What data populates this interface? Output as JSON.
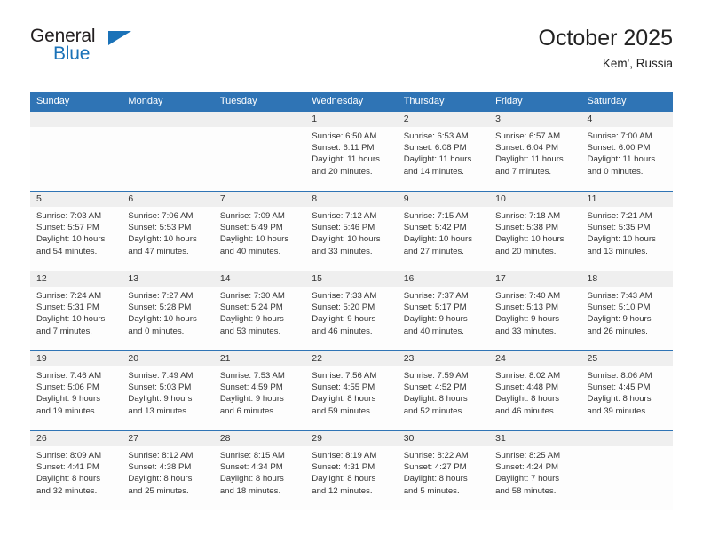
{
  "brand": {
    "name_top": "General",
    "name_bottom": "Blue",
    "mark": "triangle-logo-mark",
    "accent_color": "#1a72b8"
  },
  "header": {
    "title": "October 2025",
    "subtitle": "Kem', Russia"
  },
  "theme": {
    "header_blue": "#2f74b5",
    "datebar_gray": "#efefef",
    "text": "#333333"
  },
  "weekday_headers": [
    "Sunday",
    "Monday",
    "Tuesday",
    "Wednesday",
    "Thursday",
    "Friday",
    "Saturday"
  ],
  "labels": {
    "sunrise": "Sunrise:",
    "sunset": "Sunset:",
    "daylight": "Daylight:"
  },
  "weeks": [
    [
      {
        "day": "",
        "sunrise": "",
        "sunset": "",
        "daylight_1": "",
        "daylight_2": "",
        "empty": true
      },
      {
        "day": "",
        "sunrise": "",
        "sunset": "",
        "daylight_1": "",
        "daylight_2": "",
        "empty": true
      },
      {
        "day": "",
        "sunrise": "",
        "sunset": "",
        "daylight_1": "",
        "daylight_2": "",
        "empty": true
      },
      {
        "day": "1",
        "sunrise": "Sunrise: 6:50 AM",
        "sunset": "Sunset: 6:11 PM",
        "daylight_1": "Daylight: 11 hours",
        "daylight_2": "and 20 minutes.",
        "empty": false
      },
      {
        "day": "2",
        "sunrise": "Sunrise: 6:53 AM",
        "sunset": "Sunset: 6:08 PM",
        "daylight_1": "Daylight: 11 hours",
        "daylight_2": "and 14 minutes.",
        "empty": false
      },
      {
        "day": "3",
        "sunrise": "Sunrise: 6:57 AM",
        "sunset": "Sunset: 6:04 PM",
        "daylight_1": "Daylight: 11 hours",
        "daylight_2": "and 7 minutes.",
        "empty": false
      },
      {
        "day": "4",
        "sunrise": "Sunrise: 7:00 AM",
        "sunset": "Sunset: 6:00 PM",
        "daylight_1": "Daylight: 11 hours",
        "daylight_2": "and 0 minutes.",
        "empty": false
      }
    ],
    [
      {
        "day": "5",
        "sunrise": "Sunrise: 7:03 AM",
        "sunset": "Sunset: 5:57 PM",
        "daylight_1": "Daylight: 10 hours",
        "daylight_2": "and 54 minutes.",
        "empty": false
      },
      {
        "day": "6",
        "sunrise": "Sunrise: 7:06 AM",
        "sunset": "Sunset: 5:53 PM",
        "daylight_1": "Daylight: 10 hours",
        "daylight_2": "and 47 minutes.",
        "empty": false
      },
      {
        "day": "7",
        "sunrise": "Sunrise: 7:09 AM",
        "sunset": "Sunset: 5:49 PM",
        "daylight_1": "Daylight: 10 hours",
        "daylight_2": "and 40 minutes.",
        "empty": false
      },
      {
        "day": "8",
        "sunrise": "Sunrise: 7:12 AM",
        "sunset": "Sunset: 5:46 PM",
        "daylight_1": "Daylight: 10 hours",
        "daylight_2": "and 33 minutes.",
        "empty": false
      },
      {
        "day": "9",
        "sunrise": "Sunrise: 7:15 AM",
        "sunset": "Sunset: 5:42 PM",
        "daylight_1": "Daylight: 10 hours",
        "daylight_2": "and 27 minutes.",
        "empty": false
      },
      {
        "day": "10",
        "sunrise": "Sunrise: 7:18 AM",
        "sunset": "Sunset: 5:38 PM",
        "daylight_1": "Daylight: 10 hours",
        "daylight_2": "and 20 minutes.",
        "empty": false
      },
      {
        "day": "11",
        "sunrise": "Sunrise: 7:21 AM",
        "sunset": "Sunset: 5:35 PM",
        "daylight_1": "Daylight: 10 hours",
        "daylight_2": "and 13 minutes.",
        "empty": false
      }
    ],
    [
      {
        "day": "12",
        "sunrise": "Sunrise: 7:24 AM",
        "sunset": "Sunset: 5:31 PM",
        "daylight_1": "Daylight: 10 hours",
        "daylight_2": "and 7 minutes.",
        "empty": false
      },
      {
        "day": "13",
        "sunrise": "Sunrise: 7:27 AM",
        "sunset": "Sunset: 5:28 PM",
        "daylight_1": "Daylight: 10 hours",
        "daylight_2": "and 0 minutes.",
        "empty": false
      },
      {
        "day": "14",
        "sunrise": "Sunrise: 7:30 AM",
        "sunset": "Sunset: 5:24 PM",
        "daylight_1": "Daylight: 9 hours",
        "daylight_2": "and 53 minutes.",
        "empty": false
      },
      {
        "day": "15",
        "sunrise": "Sunrise: 7:33 AM",
        "sunset": "Sunset: 5:20 PM",
        "daylight_1": "Daylight: 9 hours",
        "daylight_2": "and 46 minutes.",
        "empty": false
      },
      {
        "day": "16",
        "sunrise": "Sunrise: 7:37 AM",
        "sunset": "Sunset: 5:17 PM",
        "daylight_1": "Daylight: 9 hours",
        "daylight_2": "and 40 minutes.",
        "empty": false
      },
      {
        "day": "17",
        "sunrise": "Sunrise: 7:40 AM",
        "sunset": "Sunset: 5:13 PM",
        "daylight_1": "Daylight: 9 hours",
        "daylight_2": "and 33 minutes.",
        "empty": false
      },
      {
        "day": "18",
        "sunrise": "Sunrise: 7:43 AM",
        "sunset": "Sunset: 5:10 PM",
        "daylight_1": "Daylight: 9 hours",
        "daylight_2": "and 26 minutes.",
        "empty": false
      }
    ],
    [
      {
        "day": "19",
        "sunrise": "Sunrise: 7:46 AM",
        "sunset": "Sunset: 5:06 PM",
        "daylight_1": "Daylight: 9 hours",
        "daylight_2": "and 19 minutes.",
        "empty": false
      },
      {
        "day": "20",
        "sunrise": "Sunrise: 7:49 AM",
        "sunset": "Sunset: 5:03 PM",
        "daylight_1": "Daylight: 9 hours",
        "daylight_2": "and 13 minutes.",
        "empty": false
      },
      {
        "day": "21",
        "sunrise": "Sunrise: 7:53 AM",
        "sunset": "Sunset: 4:59 PM",
        "daylight_1": "Daylight: 9 hours",
        "daylight_2": "and 6 minutes.",
        "empty": false
      },
      {
        "day": "22",
        "sunrise": "Sunrise: 7:56 AM",
        "sunset": "Sunset: 4:55 PM",
        "daylight_1": "Daylight: 8 hours",
        "daylight_2": "and 59 minutes.",
        "empty": false
      },
      {
        "day": "23",
        "sunrise": "Sunrise: 7:59 AM",
        "sunset": "Sunset: 4:52 PM",
        "daylight_1": "Daylight: 8 hours",
        "daylight_2": "and 52 minutes.",
        "empty": false
      },
      {
        "day": "24",
        "sunrise": "Sunrise: 8:02 AM",
        "sunset": "Sunset: 4:48 PM",
        "daylight_1": "Daylight: 8 hours",
        "daylight_2": "and 46 minutes.",
        "empty": false
      },
      {
        "day": "25",
        "sunrise": "Sunrise: 8:06 AM",
        "sunset": "Sunset: 4:45 PM",
        "daylight_1": "Daylight: 8 hours",
        "daylight_2": "and 39 minutes.",
        "empty": false
      }
    ],
    [
      {
        "day": "26",
        "sunrise": "Sunrise: 8:09 AM",
        "sunset": "Sunset: 4:41 PM",
        "daylight_1": "Daylight: 8 hours",
        "daylight_2": "and 32 minutes.",
        "empty": false
      },
      {
        "day": "27",
        "sunrise": "Sunrise: 8:12 AM",
        "sunset": "Sunset: 4:38 PM",
        "daylight_1": "Daylight: 8 hours",
        "daylight_2": "and 25 minutes.",
        "empty": false
      },
      {
        "day": "28",
        "sunrise": "Sunrise: 8:15 AM",
        "sunset": "Sunset: 4:34 PM",
        "daylight_1": "Daylight: 8 hours",
        "daylight_2": "and 18 minutes.",
        "empty": false
      },
      {
        "day": "29",
        "sunrise": "Sunrise: 8:19 AM",
        "sunset": "Sunset: 4:31 PM",
        "daylight_1": "Daylight: 8 hours",
        "daylight_2": "and 12 minutes.",
        "empty": false
      },
      {
        "day": "30",
        "sunrise": "Sunrise: 8:22 AM",
        "sunset": "Sunset: 4:27 PM",
        "daylight_1": "Daylight: 8 hours",
        "daylight_2": "and 5 minutes.",
        "empty": false
      },
      {
        "day": "31",
        "sunrise": "Sunrise: 8:25 AM",
        "sunset": "Sunset: 4:24 PM",
        "daylight_1": "Daylight: 7 hours",
        "daylight_2": "and 58 minutes.",
        "empty": false
      },
      {
        "day": "",
        "sunrise": "",
        "sunset": "",
        "daylight_1": "",
        "daylight_2": "",
        "empty": true
      }
    ]
  ]
}
